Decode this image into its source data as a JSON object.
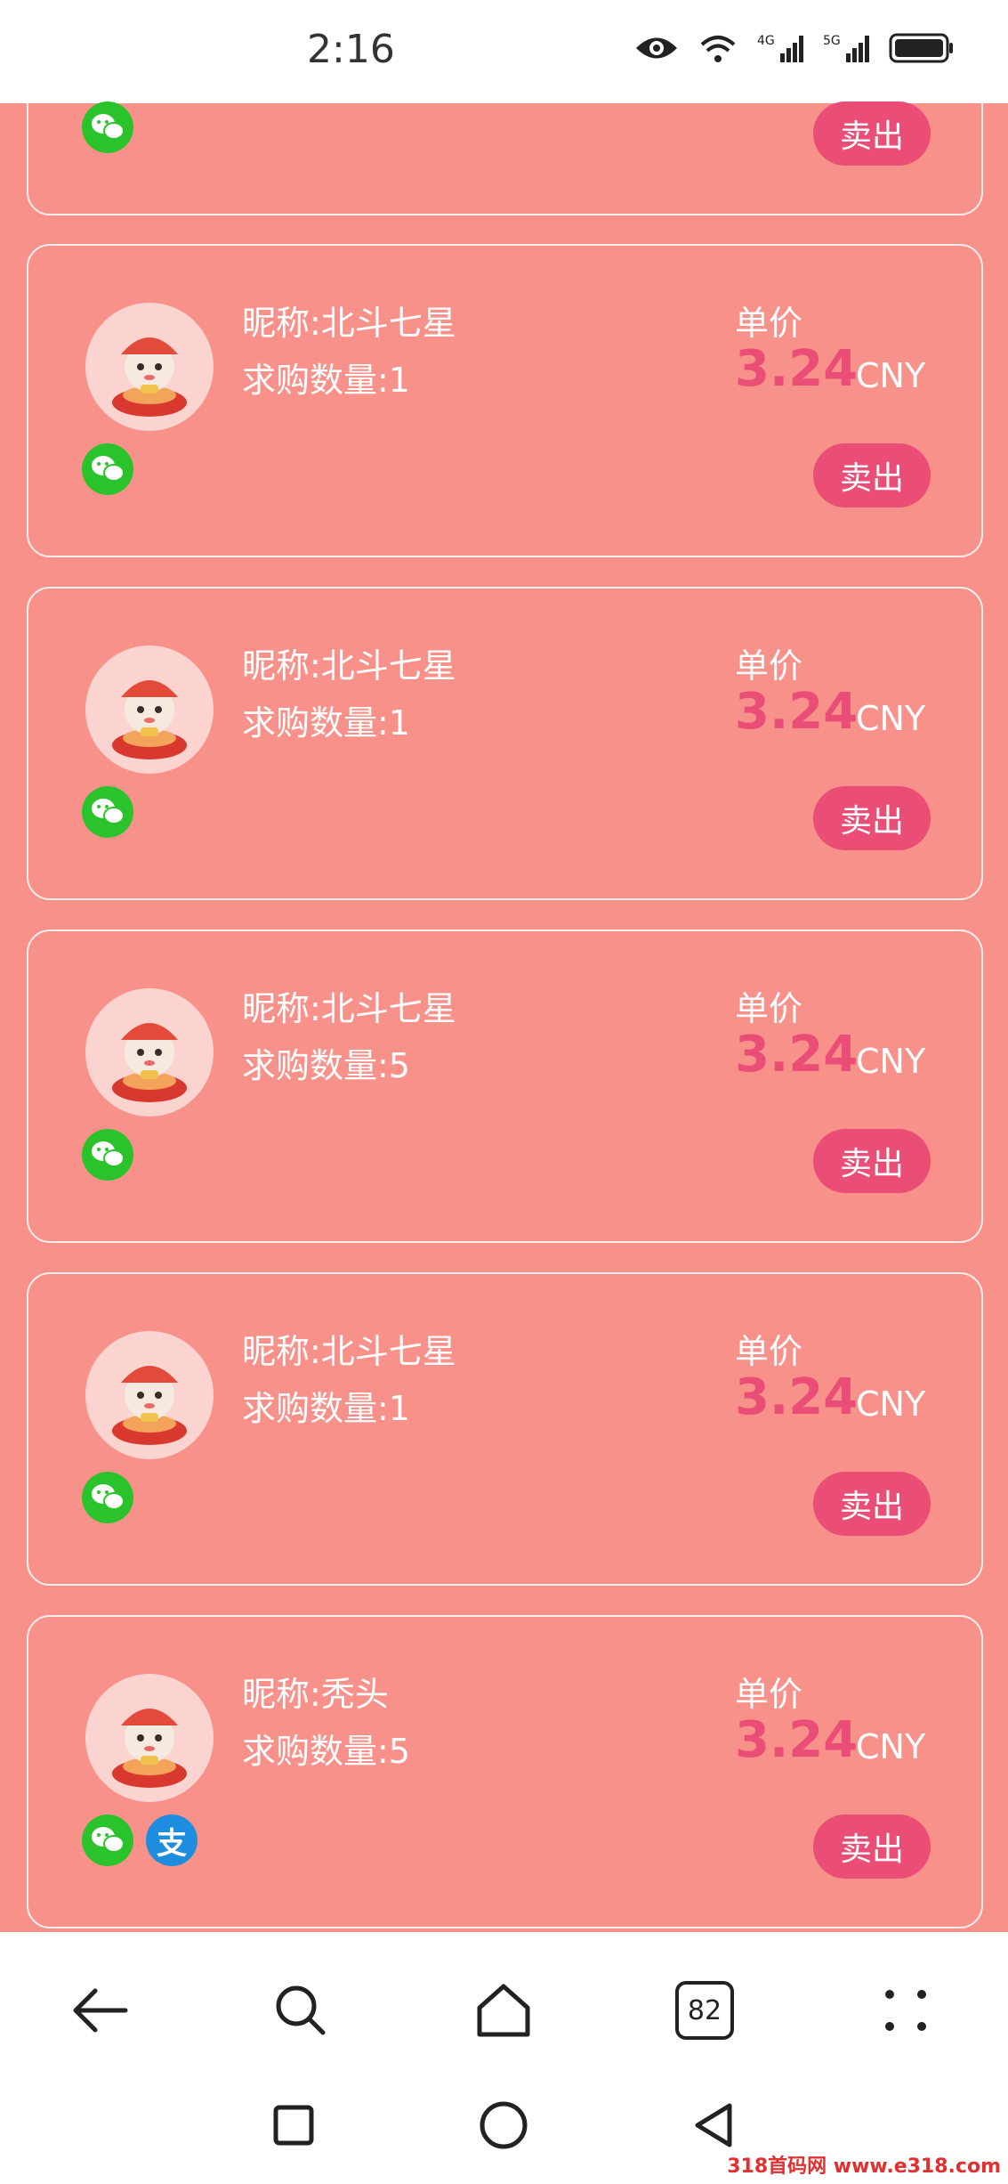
{
  "status_bar": {
    "time": "2:16"
  },
  "partial_card": {
    "sell_label": "卖出"
  },
  "cards": [
    {
      "nickname": "昵称:北斗七星",
      "quantity": "求购数量:1",
      "price_label": "单价",
      "price": "3.24",
      "currency": "CNY",
      "sell_label": "卖出",
      "payments": [
        "wechat-icon"
      ]
    },
    {
      "nickname": "昵称:北斗七星",
      "quantity": "求购数量:1",
      "price_label": "单价",
      "price": "3.24",
      "currency": "CNY",
      "sell_label": "卖出",
      "payments": [
        "wechat-icon"
      ]
    },
    {
      "nickname": "昵称:北斗七星",
      "quantity": "求购数量:5",
      "price_label": "单价",
      "price": "3.24",
      "currency": "CNY",
      "sell_label": "卖出",
      "payments": [
        "wechat-icon"
      ]
    },
    {
      "nickname": "昵称:北斗七星",
      "quantity": "求购数量:1",
      "price_label": "单价",
      "price": "3.24",
      "currency": "CNY",
      "sell_label": "卖出",
      "payments": [
        "wechat-icon"
      ]
    },
    {
      "nickname": "昵称:秃头",
      "quantity": "求购数量:5",
      "price_label": "单价",
      "price": "3.24",
      "currency": "CNY",
      "sell_label": "卖出",
      "payments": [
        "wechat-icon",
        "alipay-icon"
      ]
    }
  ],
  "alipay_glyph": "支",
  "browser_nav": {
    "tab_count": "82"
  },
  "watermark": "318首码网 www.e318.com",
  "colors": {
    "background": "#f8918a",
    "accent": "#ea4d75",
    "wechat": "#2bc32b",
    "alipay": "#1f8ddf"
  }
}
